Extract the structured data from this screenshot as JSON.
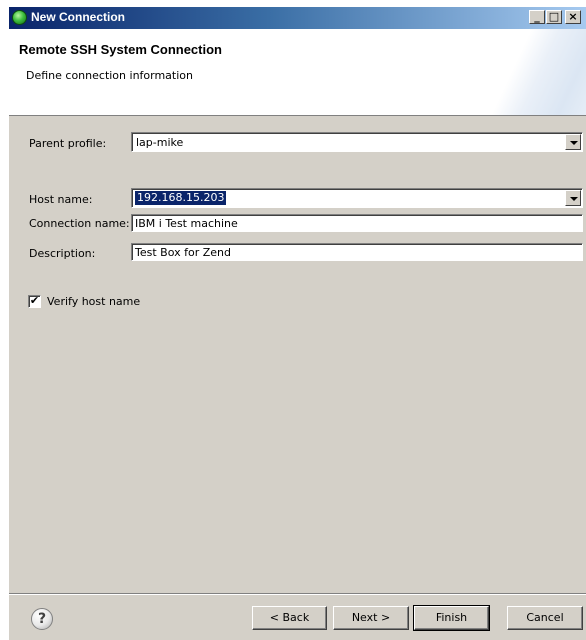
{
  "window": {
    "title": "New Connection",
    "controls": {
      "minimize": "_",
      "maximize": "□",
      "close": "×"
    }
  },
  "banner": {
    "title": "Remote SSH System Connection",
    "subtitle": "Define connection information"
  },
  "form": {
    "parent_profile": {
      "label": "Parent profile:",
      "value": "lap-mike"
    },
    "host_name": {
      "label": "Host name:",
      "value": "192.168.15.203"
    },
    "connection_name": {
      "label": "Connection name:",
      "value": "IBM i Test machine"
    },
    "description": {
      "label": "Description:",
      "value": "Test Box for Zend"
    },
    "verify_host": {
      "label": "Verify host name",
      "checked": true,
      "mark": "✔"
    }
  },
  "footer": {
    "help": "?",
    "back": "< Back",
    "next": "Next >",
    "finish": "Finish",
    "cancel": "Cancel"
  },
  "colors": {
    "selection": "#0a246a",
    "dialog": "#d4d0c8",
    "title_start": "#0a246a",
    "title_end": "#a6caf0"
  }
}
